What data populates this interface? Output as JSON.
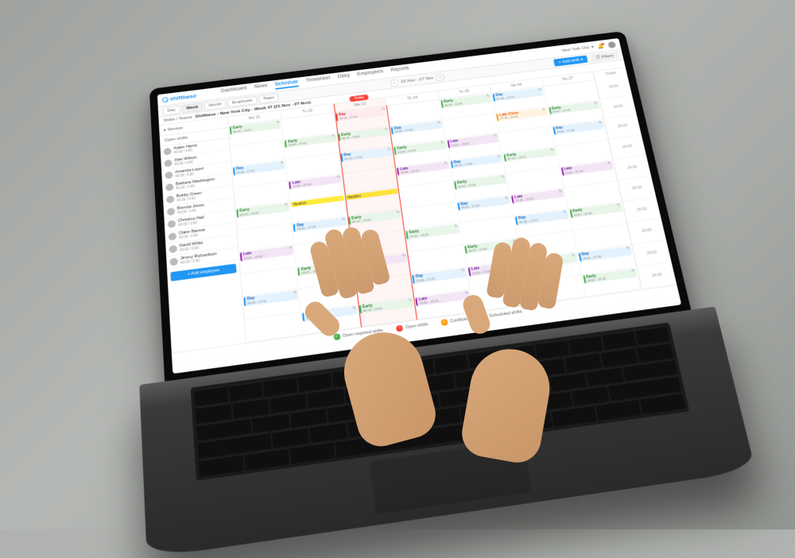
{
  "brand": "shiftbase",
  "nav": {
    "items": [
      "Dashboard",
      "News",
      "Schedule",
      "Timesheet",
      "Diary",
      "Employees",
      "Reports"
    ],
    "active": "Schedule"
  },
  "location": {
    "label": "New York City",
    "notif_count": "2"
  },
  "toolbar": {
    "views": [
      "Day",
      "Week",
      "Month",
      "Employee",
      "Team"
    ],
    "active_view": "Week",
    "date_range": "21 Nov - 27 Nov",
    "add_shift": "+ Add shift",
    "filters": "Filters"
  },
  "crumb": {
    "a": "Shifts / Teams",
    "b": "Shiftbase - New York City - Week 47 (21 Nov - 27 Nov)"
  },
  "days": [
    "Mo 21",
    "Tu 22",
    "We 23",
    "Th 24",
    "Fr 25",
    "Sa 26",
    "Su 27"
  ],
  "today_label": "Today",
  "totals_header": "Totals",
  "open_shifts_label": "Open shifts",
  "service_label": "Service",
  "add_employee": "+ Add employee",
  "employees": [
    {
      "name": "Adam Harris",
      "hours": "40:00 / 0:00"
    },
    {
      "name": "Alan Wilson",
      "hours": "40:00 / 0:00"
    },
    {
      "name": "Amanda Lopez",
      "hours": "40:00 / 0:00"
    },
    {
      "name": "Barbara Washington",
      "hours": "40:00 / 0:00"
    },
    {
      "name": "Bobby Green",
      "hours": "40:00 / 0:00"
    },
    {
      "name": "Brenda Jones",
      "hours": "40:00 / 0:00"
    },
    {
      "name": "Christine Hall",
      "hours": "40:00 / 0:00"
    },
    {
      "name": "Claire Barrow",
      "hours": "40:00 / 0:00"
    },
    {
      "name": "David White",
      "hours": "40:00 / 0:00"
    },
    {
      "name": "Jimmy Richardson",
      "hours": "40:00 / 0:00"
    }
  ],
  "totals": [
    "24:00",
    "24:00",
    "24:00",
    "24:00",
    "24:00",
    "24:00",
    "24:00",
    "24:00",
    "24:00",
    "24:00"
  ],
  "shifts": {
    "early": {
      "name": "Early",
      "time": "06:00 - 14:00"
    },
    "day": {
      "name": "Day",
      "time": "09:00 - 17:00"
    },
    "late": {
      "name": "Late",
      "time": "14:00 - 22:00"
    },
    "close": {
      "name": "Late Close",
      "time": "17:00 - 01:00"
    }
  },
  "vacation": "Vacation",
  "legend": {
    "a": "Open required shifts",
    "b": "Open shifts",
    "c": "Conflicts",
    "d": "Scheduled shifts"
  }
}
